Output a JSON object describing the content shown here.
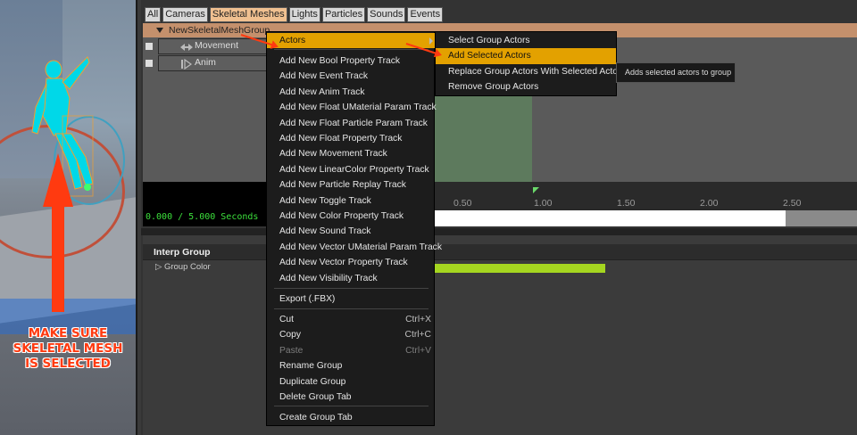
{
  "tabs": [
    {
      "label": "All"
    },
    {
      "label": "Cameras"
    },
    {
      "label": "Skeletal Meshes",
      "selected": true
    },
    {
      "label": "Lights"
    },
    {
      "label": "Particles"
    },
    {
      "label": "Sounds"
    },
    {
      "label": "Events"
    }
  ],
  "group": {
    "name": "NewSkeletalMeshGroup"
  },
  "tracks": [
    {
      "label": "Movement",
      "icon": "movement-icon"
    },
    {
      "label": "Anim",
      "icon": "anim-icon"
    }
  ],
  "timeline": {
    "readout": "0.000 / 5.000 Seconds",
    "ticks": [
      "0.50",
      "1.00",
      "1.50",
      "2.00",
      "2.50"
    ]
  },
  "details": {
    "section": "Interp Group",
    "property": "Group Color",
    "color": "#a5d620"
  },
  "context_menu": {
    "items": [
      {
        "label": "Actors",
        "submenu": true,
        "highlighted": true
      },
      {
        "label": "Add New Bool Property Track"
      },
      {
        "label": "Add New Event Track"
      },
      {
        "label": "Add New Anim Track"
      },
      {
        "label": "Add New Float UMaterial Param Track"
      },
      {
        "label": "Add New Float Particle Param Track"
      },
      {
        "label": "Add New Float Property Track"
      },
      {
        "label": "Add New Movement Track"
      },
      {
        "label": "Add New LinearColor Property Track"
      },
      {
        "label": "Add New Particle Replay Track"
      },
      {
        "label": "Add New Toggle Track"
      },
      {
        "label": "Add New Color Property Track"
      },
      {
        "label": "Add New Sound Track"
      },
      {
        "label": "Add New Vector UMaterial Param Track"
      },
      {
        "label": "Add New Vector Property Track"
      },
      {
        "label": "Add New Visibility Track"
      },
      {
        "label": "Export (.FBX)"
      },
      {
        "label": "Cut",
        "shortcut": "Ctrl+X"
      },
      {
        "label": "Copy",
        "shortcut": "Ctrl+C"
      },
      {
        "label": "Paste",
        "shortcut": "Ctrl+V",
        "disabled": true
      },
      {
        "label": "Rename Group"
      },
      {
        "label": "Duplicate Group"
      },
      {
        "label": "Delete Group Tab"
      },
      {
        "label": "Create Group Tab"
      }
    ]
  },
  "submenu": {
    "items": [
      {
        "label": "Select Group Actors"
      },
      {
        "label": "Add Selected Actors",
        "highlighted": true
      },
      {
        "label": "Replace Group Actors With Selected Actors"
      },
      {
        "label": "Remove Group Actors"
      }
    ]
  },
  "tooltip": "Adds selected actors to group",
  "annotation": {
    "lines": [
      "MAKE SURE",
      "SKELETAL MESH",
      "IS SELECTED"
    ],
    "color": "#ff3a10"
  }
}
